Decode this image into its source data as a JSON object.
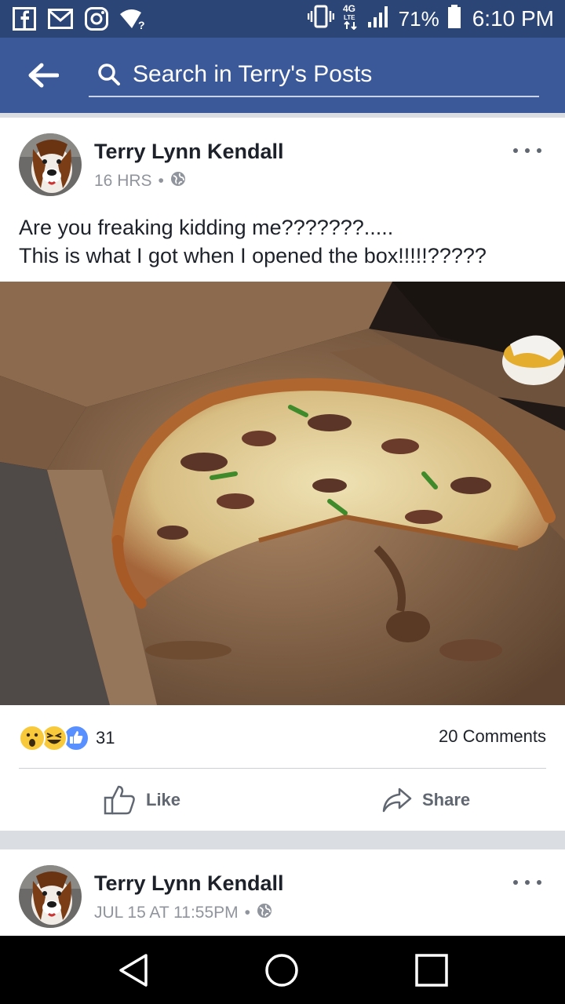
{
  "status_bar": {
    "icons_left": [
      "facebook-icon",
      "gmail-icon",
      "instagram-icon",
      "wifi-question-icon"
    ],
    "icons_right": [
      "vibrate-icon",
      "4g-lte-icon",
      "signal-icon",
      "battery-icon"
    ],
    "network": "4G LTE",
    "battery": "71%",
    "time": "6:10 PM"
  },
  "search": {
    "placeholder": "Search in Terry's Posts"
  },
  "post1": {
    "author": "Terry Lynn Kendall",
    "time": "16 HRS",
    "separator": "•",
    "text_line1": "Are you freaking kidding me???????.....",
    "text_line2": "This is what I got when I opened the box!!!!!?????",
    "reactions": [
      "wow",
      "haha",
      "like"
    ],
    "reaction_count": "31",
    "comments": "20 Comments",
    "like_label": "Like",
    "share_label": "Share"
  },
  "post2": {
    "author": "Terry Lynn Kendall",
    "time": "JUL 15 AT 11:55PM",
    "separator": "•"
  },
  "colors": {
    "status_bar": "#2c4577",
    "header": "#3b5998",
    "text": "#1d2129",
    "meta": "#90949c",
    "like_blue": "#5890ff",
    "reaction_yellow": "#f7c93b"
  }
}
